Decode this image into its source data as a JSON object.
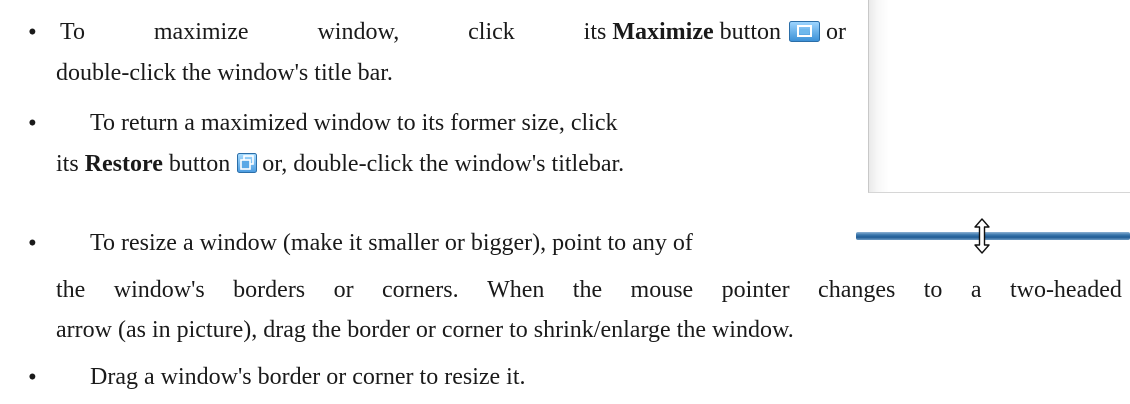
{
  "bullets": [
    {
      "line1_words": [
        "To",
        "maximize",
        "window,",
        "click",
        "its"
      ],
      "line1_bold": "Maximize",
      "line1_after": "button",
      "line1_end": "or",
      "line2": "double-click the window's title bar.",
      "icon": "maximize-icon"
    },
    {
      "line1": "To return a maximized window to its former size, click",
      "line2_before": "its",
      "line2_bold": "Restore",
      "line2_after": "button",
      "line2_end": "or, double-click the window's titlebar.",
      "icon": "restore-icon"
    },
    {
      "line1": "To resize a window (make it smaller or bigger), point to any of",
      "line2_words": [
        "the",
        "window's",
        "borders",
        "or",
        "corners.",
        "When",
        "the",
        "mouse",
        "pointer",
        "changes",
        "to",
        "a",
        "two-headed"
      ],
      "line3": "arrow (as in picture), drag the border or corner to shrink/enlarge the window."
    },
    {
      "line1": "Drag a window's border or corner to resize it."
    }
  ],
  "bullet_char": "•",
  "image": {
    "cursor_icon": "double-arrow-vertical-icon",
    "border_color": "#2f6aa3"
  }
}
